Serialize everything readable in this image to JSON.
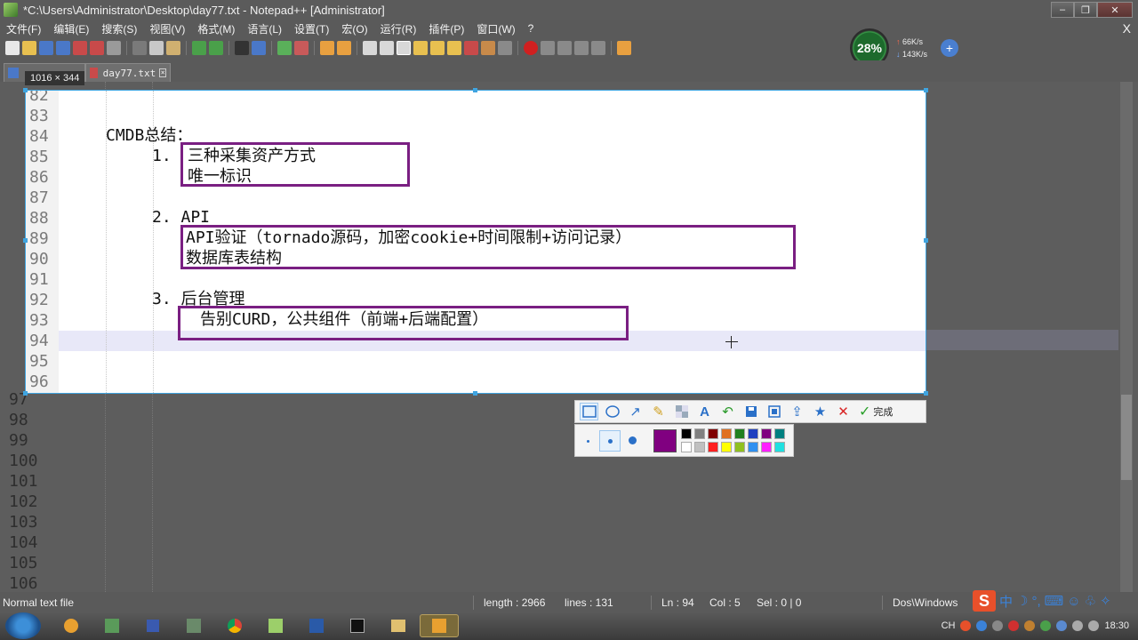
{
  "window": {
    "title": "*C:\\Users\\Administrator\\Desktop\\day77.txt - Notepad++ [Administrator]",
    "btn_min": "‒",
    "btn_max": "❐",
    "btn_close": "✕"
  },
  "menu": {
    "items": [
      "文件(F)",
      "编辑(E)",
      "搜索(S)",
      "视图(V)",
      "格式(M)",
      "语言(L)",
      "设置(T)",
      "宏(O)",
      "运行(R)",
      "插件(P)",
      "窗口(W)",
      "?"
    ],
    "close": "X"
  },
  "speed_widget": {
    "percent": "28%",
    "upload": "66K/s",
    "download": "143K/s"
  },
  "tab": {
    "label": "day77.txt",
    "close": "×"
  },
  "capture": {
    "size_label": "1016 × 344"
  },
  "editor": {
    "capture_lines": [
      "82",
      "83",
      "84",
      "85",
      "86",
      "87",
      "88",
      "89",
      "90",
      "91",
      "92",
      "93",
      "94",
      "95",
      "96"
    ],
    "dim_lines": [
      "97",
      "98",
      "99",
      "100",
      "101",
      "102",
      "103",
      "104",
      "105",
      "106"
    ],
    "content": {
      "line84": "CMDB总结：",
      "line85_num": "1.",
      "line85": "三种采集资产方式",
      "line86": "唯一标识",
      "line88": "2. API",
      "line89": "API验证（tornado源码，加密cookie+时间限制+访问记录）",
      "line90": "数据库表结构",
      "line92": "3. 后台管理",
      "line93": "告别CURD，公共组件（前端+后端配置）"
    }
  },
  "annotation_toolbar": {
    "done_label": "完成",
    "current_color": "#800080",
    "palette": [
      "#000000",
      "#808080",
      "#800000",
      "#e07020",
      "#208020",
      "#2040c0",
      "#800080",
      "#008080",
      "#ffffff",
      "#c0c0c0",
      "#ff2020",
      "#ffff00",
      "#90c020",
      "#3090f0",
      "#ff20ff",
      "#20e0e0"
    ]
  },
  "statusbar": {
    "file_type": "Normal text file",
    "length": "length : 2966",
    "lines": "lines : 131",
    "ln": "Ln : 94",
    "col": "Col : 5",
    "sel": "Sel : 0 | 0",
    "eol": "Dos\\Windows"
  },
  "ime": {
    "logo": "S",
    "lang": "中"
  },
  "taskbar": {
    "tray_lang": "CH",
    "clock": "18:30"
  }
}
